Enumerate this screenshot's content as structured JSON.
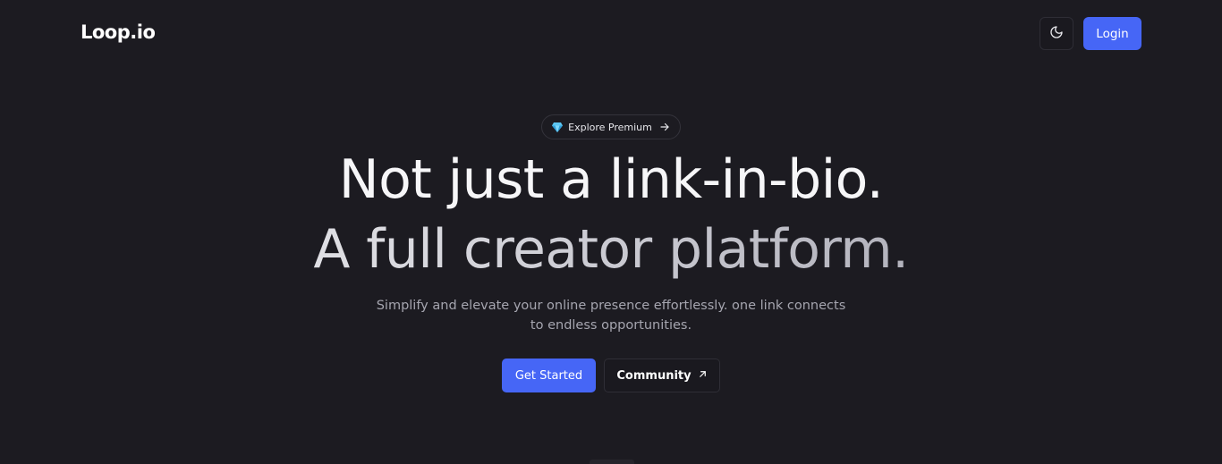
{
  "brand": {
    "name": "Loop.io"
  },
  "header": {
    "theme_toggle_icon": "moon-icon",
    "login_label": "Login"
  },
  "hero": {
    "badge": {
      "icon": "diamond-icon",
      "label": "Explore Premium",
      "arrow_icon": "arrow-right-icon"
    },
    "headline_line1": "Not just a link-in-bio.",
    "headline_line2": "A full creator platform.",
    "subheading_line1": "Simplify and elevate your online presence effortlessly. one link connects",
    "subheading_line2": "to endless opportunities.",
    "primary_cta": "Get Started",
    "secondary_cta": {
      "label": "Community",
      "icon": "arrow-up-right-icon"
    }
  },
  "colors": {
    "background": "#1c1b21",
    "accent": "#4666f6",
    "text_primary": "#f4f4f6",
    "text_muted": "#a5a5af"
  }
}
